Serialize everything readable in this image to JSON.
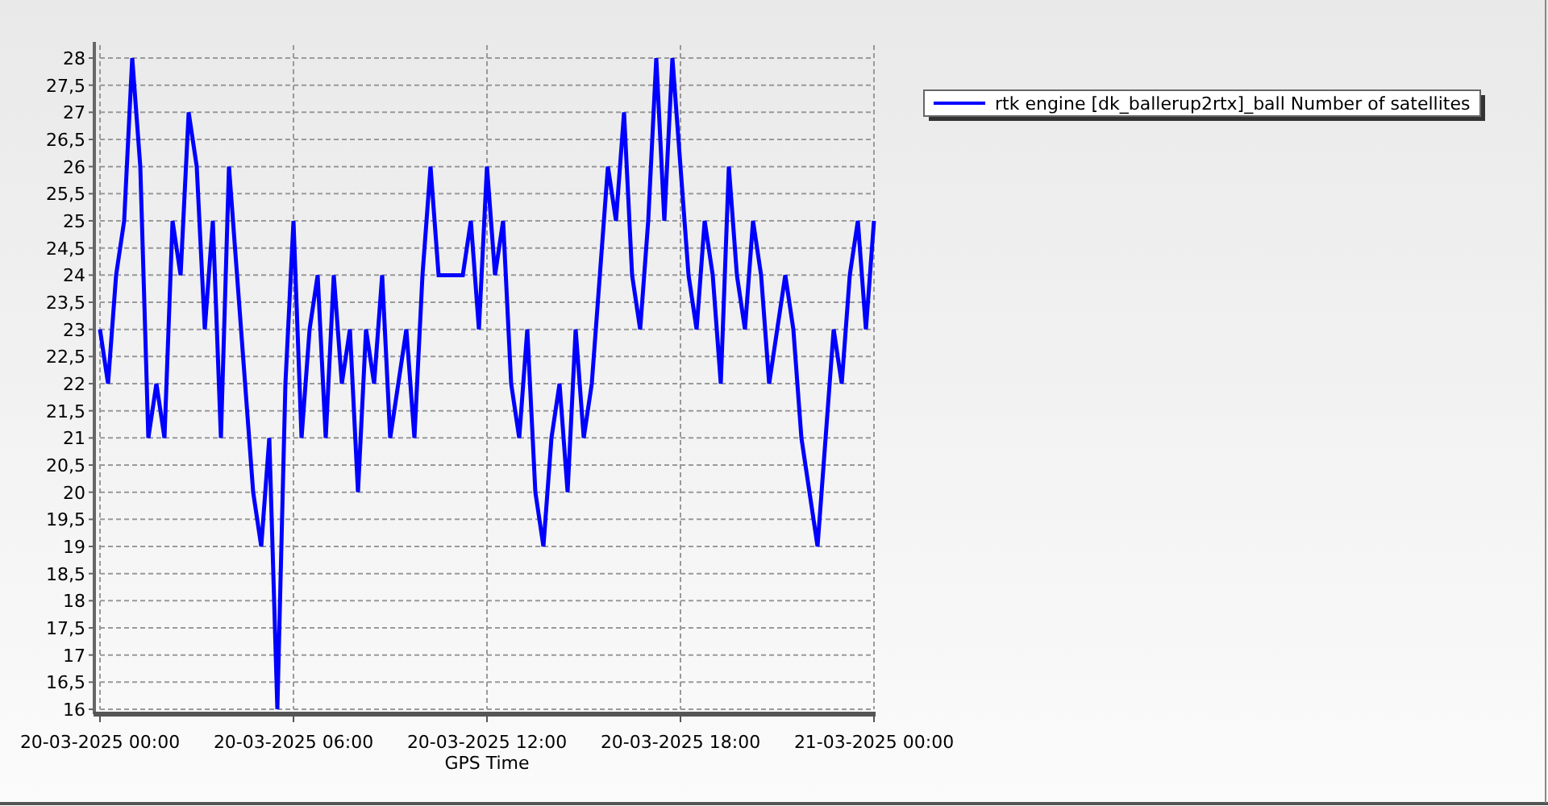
{
  "chart_data": {
    "type": "line",
    "xlabel": "GPS Time",
    "grid": true,
    "categories": [
      "20-03-2025 00:00",
      null,
      null,
      null,
      null,
      null,
      null,
      null,
      null,
      null,
      null,
      null,
      null,
      null,
      null,
      null,
      null,
      null,
      null,
      null,
      null,
      null,
      null,
      null,
      "20-03-2025 06:00",
      null,
      null,
      null,
      null,
      null,
      null,
      null,
      null,
      null,
      null,
      null,
      null,
      null,
      null,
      null,
      null,
      null,
      null,
      null,
      null,
      null,
      null,
      null,
      "20-03-2025 12:00",
      null,
      null,
      null,
      null,
      null,
      null,
      null,
      null,
      null,
      null,
      null,
      null,
      null,
      null,
      null,
      null,
      null,
      null,
      null,
      null,
      null,
      null,
      null,
      "20-03-2025 18:00",
      null,
      null,
      null,
      null,
      null,
      null,
      null,
      null,
      null,
      null,
      null,
      null,
      null,
      null,
      null,
      null,
      null,
      null,
      null,
      null,
      null,
      null,
      null,
      "21-03-2025 00:00"
    ],
    "series": [
      {
        "name": "rtk engine [dk_ballerup2rtx]_ball Number of satellites",
        "color": "#0000ff",
        "values": [
          23,
          22,
          24,
          25,
          28,
          26,
          21,
          22,
          21,
          25,
          24,
          27,
          26,
          23,
          25,
          21,
          26,
          24,
          22,
          20,
          19,
          21,
          16,
          22,
          25,
          21,
          23,
          24,
          21,
          24,
          22,
          23,
          20,
          23,
          22,
          24,
          21,
          22,
          23,
          21,
          24,
          26,
          24,
          24,
          24,
          24,
          25,
          23,
          26,
          24,
          25,
          22,
          21,
          23,
          20,
          19,
          21,
          22,
          20,
          23,
          21,
          22,
          24,
          26,
          25,
          27,
          24,
          23,
          25,
          28,
          25,
          28,
          26,
          24,
          23,
          25,
          24,
          22,
          26,
          24,
          23,
          25,
          24,
          22,
          23,
          24,
          23,
          21,
          20,
          19,
          21,
          23,
          22,
          24,
          25,
          23,
          25
        ]
      }
    ],
    "ylim": [
      16,
      28
    ],
    "yticks": [
      {
        "value": 16,
        "label": "16"
      },
      {
        "value": 16.5,
        "label": "16,5"
      },
      {
        "value": 17,
        "label": "17"
      },
      {
        "value": 17.5,
        "label": "17,5"
      },
      {
        "value": 18,
        "label": "18"
      },
      {
        "value": 18.5,
        "label": "18,5"
      },
      {
        "value": 19,
        "label": "19"
      },
      {
        "value": 19.5,
        "label": "19,5"
      },
      {
        "value": 20,
        "label": "20"
      },
      {
        "value": 20.5,
        "label": "20,5"
      },
      {
        "value": 21,
        "label": "21"
      },
      {
        "value": 21.5,
        "label": "21,5"
      },
      {
        "value": 22,
        "label": "22"
      },
      {
        "value": 22.5,
        "label": "22,5"
      },
      {
        "value": 23,
        "label": "23"
      },
      {
        "value": 23.5,
        "label": "23,5"
      },
      {
        "value": 24,
        "label": "24"
      },
      {
        "value": 24.5,
        "label": "24,5"
      },
      {
        "value": 25,
        "label": "25"
      },
      {
        "value": 25.5,
        "label": "25,5"
      },
      {
        "value": 26,
        "label": "26"
      },
      {
        "value": 26.5,
        "label": "26,5"
      },
      {
        "value": 27,
        "label": "27"
      },
      {
        "value": 27.5,
        "label": "27,5"
      },
      {
        "value": 28,
        "label": "28"
      }
    ]
  }
}
